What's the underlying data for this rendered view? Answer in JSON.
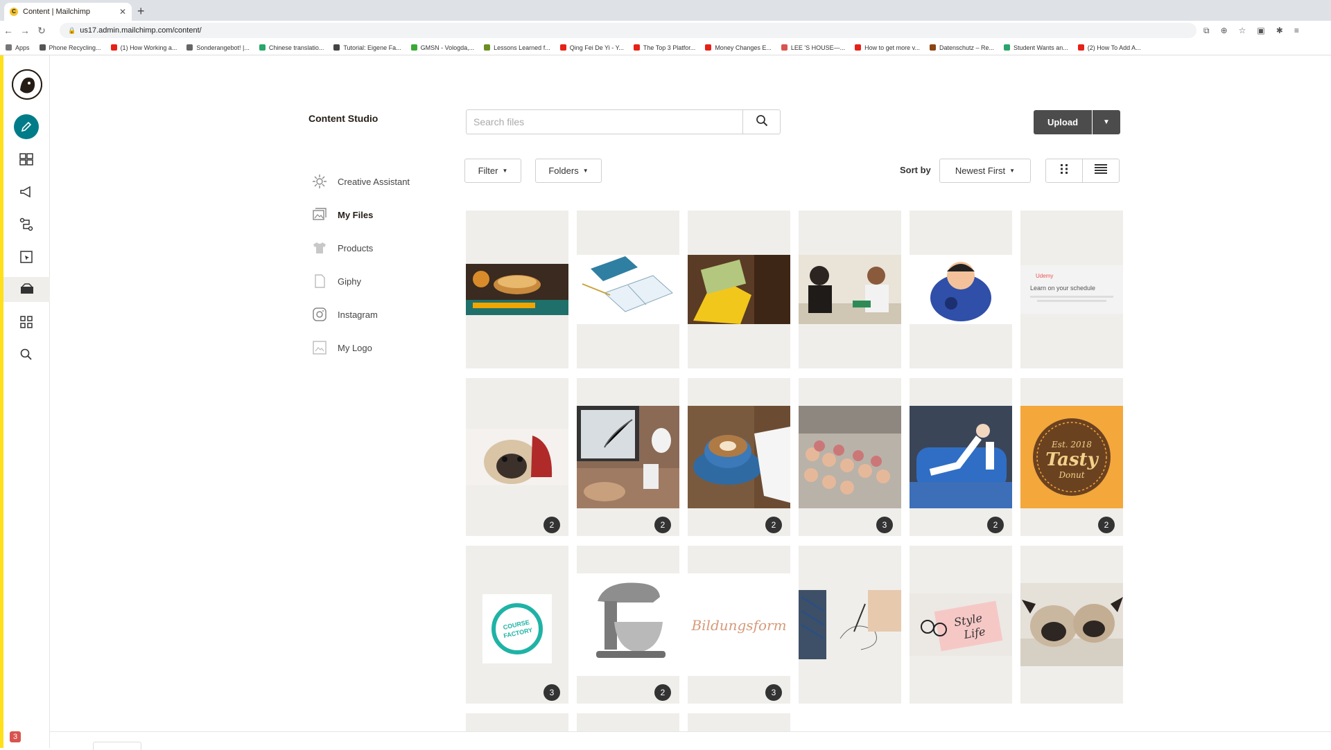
{
  "browser": {
    "tab_title": "Content | Mailchimp",
    "url": "us17.admin.mailchimp.com/content/",
    "bookmarks": [
      {
        "label": "Apps",
        "color": "#777777"
      },
      {
        "label": "Phone Recycling...",
        "color": "#555555"
      },
      {
        "label": "(1) How Working a...",
        "color": "#e62117"
      },
      {
        "label": "Sonderangebot! |...",
        "color": "#666666"
      },
      {
        "label": "Chinese translatio...",
        "color": "#2aa56b"
      },
      {
        "label": "Tutorial: Eigene Fa...",
        "color": "#444444"
      },
      {
        "label": "GMSN - Vologda,...",
        "color": "#3aaa35"
      },
      {
        "label": "Lessons Learned f...",
        "color": "#6b8e23"
      },
      {
        "label": "Qing Fei De Yi - Y...",
        "color": "#e62117"
      },
      {
        "label": "The Top 3 Platfor...",
        "color": "#e62117"
      },
      {
        "label": "Money Changes E...",
        "color": "#e62117"
      },
      {
        "label": "LEE 'S HOUSE—...",
        "color": "#d9534f"
      },
      {
        "label": "How to get more v...",
        "color": "#e62117"
      },
      {
        "label": "Datenschutz – Re...",
        "color": "#8b4513"
      },
      {
        "label": "Student Wants an...",
        "color": "#2aa56b"
      },
      {
        "label": "(2) How To Add A...",
        "color": "#e62117"
      }
    ]
  },
  "studio": {
    "title": "Content Studio",
    "search_placeholder": "Search files",
    "upload_label": "Upload",
    "filter_label": "Filter",
    "folders_label": "Folders",
    "sort_by_label": "Sort by",
    "sort_value": "Newest First",
    "nav": [
      {
        "label": "Creative Assistant",
        "icon": "sparkle-icon"
      },
      {
        "label": "My Files",
        "icon": "images-icon",
        "active": true
      },
      {
        "label": "Products",
        "icon": "shirt-icon"
      },
      {
        "label": "Giphy",
        "icon": "file-icon"
      },
      {
        "label": "Instagram",
        "icon": "instagram-icon"
      },
      {
        "label": "My Logo",
        "icon": "logo-icon"
      }
    ]
  },
  "notifications_count": "3",
  "tiles": [
    {
      "desc": "pie",
      "badge": ""
    },
    {
      "desc": "notebook",
      "badge": ""
    },
    {
      "desc": "wallet",
      "badge": ""
    },
    {
      "desc": "meeting",
      "badge": ""
    },
    {
      "desc": "cartoon",
      "badge": ""
    },
    {
      "desc": "udemy",
      "badge": "",
      "caption": "Learn on your schedule"
    },
    {
      "desc": "pug",
      "badge": "2"
    },
    {
      "desc": "laptop",
      "badge": "2"
    },
    {
      "desc": "coffee",
      "badge": "2"
    },
    {
      "desc": "donuts",
      "badge": "3"
    },
    {
      "desc": "sofa",
      "badge": "2"
    },
    {
      "desc": "tasty",
      "badge": "2",
      "caption": "Tasty"
    },
    {
      "desc": "course",
      "badge": "3",
      "caption": "COURSE FACTORY"
    },
    {
      "desc": "mixer",
      "badge": "2"
    },
    {
      "desc": "script",
      "badge": "3",
      "caption": "Bildungsform"
    },
    {
      "desc": "drawing",
      "badge": ""
    },
    {
      "desc": "stylelife",
      "badge": "",
      "caption": "Style Life"
    },
    {
      "desc": "pugs2",
      "badge": ""
    }
  ]
}
